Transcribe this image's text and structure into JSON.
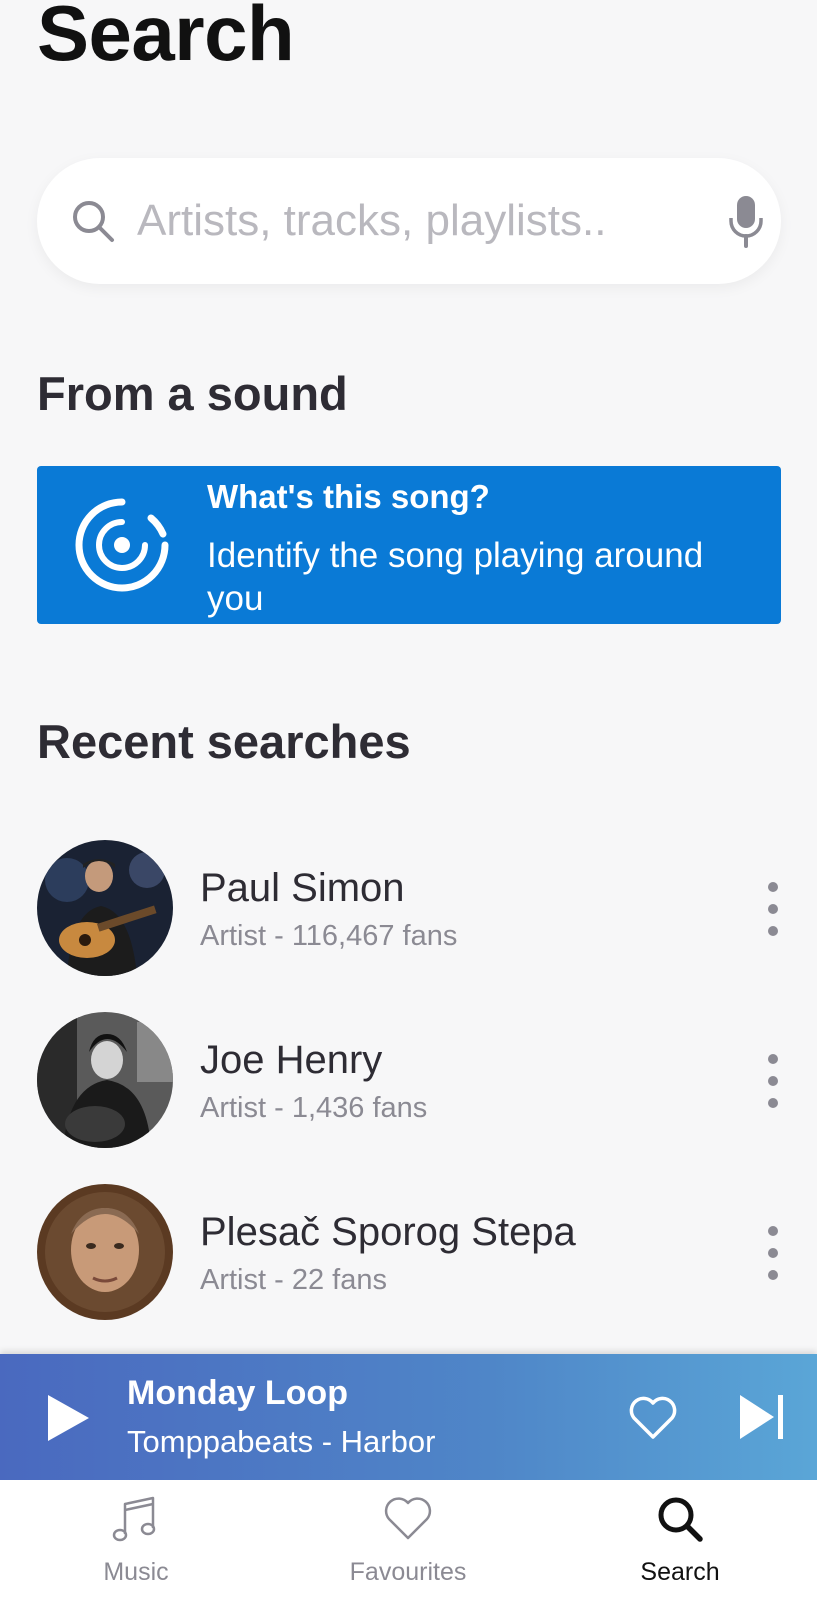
{
  "header": {
    "title": "Search"
  },
  "search": {
    "placeholder": "Artists, tracks, playlists.."
  },
  "from_sound": {
    "heading": "From a sound",
    "card_title": "What's this song?",
    "card_subtitle": "Identify the song playing around you"
  },
  "recent": {
    "heading": "Recent searches",
    "items": [
      {
        "name": "Paul Simon",
        "meta": "Artist - 116,467 fans"
      },
      {
        "name": "Joe Henry",
        "meta": "Artist - 1,436 fans"
      },
      {
        "name": "Plesač Sporog Stepa",
        "meta": "Artist - 22 fans"
      }
    ]
  },
  "player": {
    "title": "Monday Loop",
    "artist": "Tomppabeats - Harbor"
  },
  "tabs": [
    {
      "label": "Music",
      "icon": "music-note-icon",
      "active": false
    },
    {
      "label": "Favourites",
      "icon": "heart-icon",
      "active": false
    },
    {
      "label": "Search",
      "icon": "search-icon",
      "active": true
    }
  ],
  "colors": {
    "accent": "#0a7ad6",
    "background": "#f7f7f8",
    "player_gradient_start": "#4a69bf",
    "player_gradient_end": "#5aa6d7"
  }
}
